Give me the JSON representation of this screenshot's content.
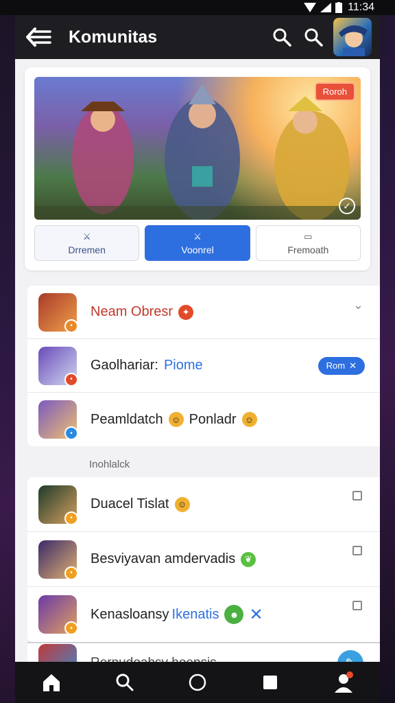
{
  "status": {
    "time": "11:34"
  },
  "appbar": {
    "title": "Komunitas"
  },
  "hero": {
    "badge": "Roroh"
  },
  "segments": [
    {
      "label": "Drremen",
      "icon": "⚔"
    },
    {
      "label": "Voonrel",
      "icon": "⚔"
    },
    {
      "label": "Fremoath",
      "icon": "▭"
    }
  ],
  "group1": [
    {
      "name": "Neam Obresr",
      "style": "red",
      "thumb": [
        "#a83a2a",
        "#f0a04a"
      ],
      "mini": "#e88a2a"
    },
    {
      "name_a": "Gaolhariar:",
      "name_b": "Piome",
      "pill": "Rom",
      "thumb": [
        "#6a4ab8",
        "#d0d8f0"
      ],
      "mini": "#e24a2a"
    },
    {
      "name_a": "Peamldatch",
      "name_b": "Ponladr",
      "thumb": [
        "#7a5ac0",
        "#f0c070"
      ],
      "mini": "#2a8ae0"
    }
  ],
  "section": "Inohlalck",
  "group2": [
    {
      "name": "Duacel Tislat",
      "thumb": [
        "#1f3a2a",
        "#d4a060"
      ],
      "mini": "#f0a020"
    },
    {
      "name": "Besviyavan amdervadis",
      "thumb": [
        "#3a2a6a",
        "#e0b070"
      ],
      "mini": "#f0a020"
    },
    {
      "name_a": "Kenasloansy",
      "name_b": "Ikenatis",
      "thumb": [
        "#6a3aa8",
        "#e0a060"
      ],
      "mini": "#f0a020"
    }
  ],
  "last": {
    "name": "Rernudoahsy hoensis"
  },
  "nav": [
    "home-icon",
    "search-icon",
    "circle-icon",
    "square-icon",
    "profile-icon"
  ]
}
